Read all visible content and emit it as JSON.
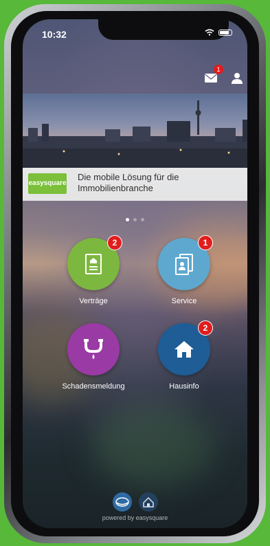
{
  "status_bar": {
    "time": "10:32"
  },
  "header": {
    "mail_badge": "1"
  },
  "banner": {
    "logo_text_a": "easy",
    "logo_text_b": "square",
    "tagline": "Die mobile Lösung für die Immobilienbranche",
    "page_count": 3,
    "active_page": 1
  },
  "tiles": [
    {
      "label": "Verträge",
      "badge": "2",
      "color": "#7cb83f",
      "icon": "contract-document-icon"
    },
    {
      "label": "Service",
      "badge": "1",
      "color": "#5ea8cf",
      "icon": "service-documents-icon"
    },
    {
      "label": "Schadensmeldung",
      "badge": "",
      "color": "#9a3aa5",
      "icon": "pipe-leak-icon"
    },
    {
      "label": "Hausinfo",
      "badge": "2",
      "color": "#1e5d96",
      "icon": "house-icon"
    }
  ],
  "footer": {
    "powered_by": "powered by easysquare"
  },
  "colors": {
    "badge": "#e11d1d",
    "background": "#57b83a"
  }
}
